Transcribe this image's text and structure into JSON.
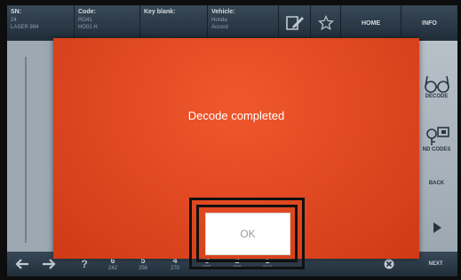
{
  "header": {
    "sn": {
      "label": "SN:",
      "values": [
        "24",
        "LASER 994"
      ]
    },
    "code": {
      "label": "Code:",
      "values": [
        "RO41",
        "HO01 H"
      ]
    },
    "key_blank": {
      "label": "Key blank:"
    },
    "vehicle": {
      "label": "Vehicle:",
      "values": [
        "Honda",
        "Accord"
      ]
    },
    "home_label": "HOME",
    "info_label": "INFO"
  },
  "right_panel": {
    "decode_label": "DECODE",
    "find_codes_label": "ND CODES",
    "back_label": "BACK"
  },
  "toolbar": {
    "help_glyph": "?",
    "cuts": [
      {
        "number": "6",
        "value": "242"
      },
      {
        "number": "5",
        "value": "256"
      },
      {
        "number": "4",
        "value": "270"
      },
      {
        "number": "3",
        "value": "285"
      },
      {
        "number": "2",
        "value": "299"
      },
      {
        "number": "1",
        "value": "313"
      }
    ],
    "next_label": "NEXT"
  },
  "dialog": {
    "message": "Decode completed",
    "ok_label": "OK"
  },
  "colors": {
    "dialog_red": "#e14a22",
    "header_dark": "#2c3a48"
  }
}
